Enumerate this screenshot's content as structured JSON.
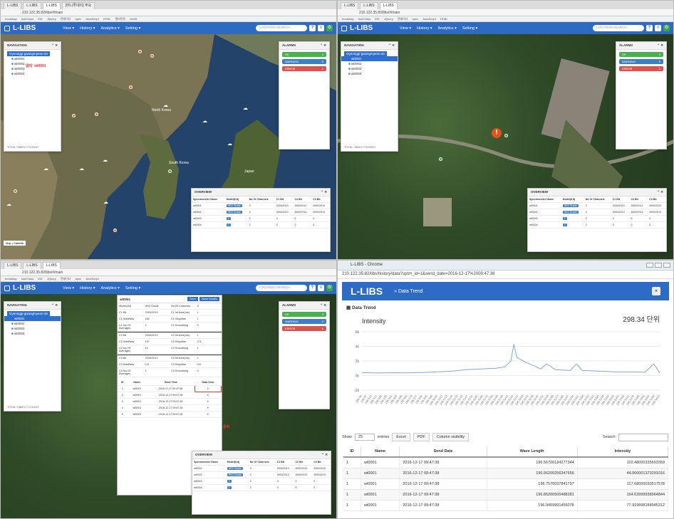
{
  "browser": {
    "tabs": [
      "L-LIBS",
      "L-LIBS",
      "L-LIBS",
      "L-LIBS",
      "[머니투데이] 주요",
      "L-LIBS"
    ],
    "address": "210.122.35.82/libs/#/main",
    "bookmarks": [
      "bootstrap",
      "tool/Class",
      "IDE",
      "JQuery",
      "컨테이너",
      "spec",
      "JavaScript",
      "HTML",
      "엘리먼트",
      "html5",
      "icons",
      "엔지니어",
      "eclipse",
      "SQL",
      "css",
      "부트스트랩",
      "Google",
      "chart",
      "hex",
      "기타 북마크"
    ]
  },
  "app": {
    "brand": "L-LIBS",
    "menus": [
      "View ▾",
      "History ▾",
      "Analytics ▾",
      "Setting ▾"
    ],
    "search_placeholder": "LOCATION SEARCH...",
    "help": "?",
    "power": "⏻"
  },
  "navigation": {
    "title": "NAVIGATION",
    "root": "Gyeonggi-gwangmyeon-do",
    "items": [
      "wt0001",
      "wt0002",
      "wt0003",
      "wt0004"
    ],
    "annotation": "'클릭' wt0001",
    "footer": "TOTAL OBJECT COUNT"
  },
  "alarms": {
    "title": "ALARMS",
    "rows": [
      {
        "label": "OK",
        "count": "3",
        "class": "ok"
      },
      {
        "label": "WARNING",
        "count": "0",
        "class": "warning"
      },
      {
        "label": "ERROR",
        "count": "1",
        "class": "error"
      }
    ]
  },
  "overview": {
    "title": "OVERVIEW",
    "columns": [
      "Spectrometer Name",
      "Model(Kit)",
      "No Of Channels",
      "C1 Bit",
      "C2 Bit",
      "C3 Bit"
    ],
    "rows": [
      [
        "wt0001",
        "HR2 Grade",
        "3",
        "2000/2013",
        "2000/2013",
        "2000/2013"
      ],
      [
        "wt0002",
        "HR2 Grade",
        "3",
        "2000/2013",
        "2000/2013",
        "2000/2013"
      ],
      [
        "wt0003",
        "2",
        "2",
        "0",
        "0",
        "0"
      ],
      [
        "wt0004",
        "2",
        "2",
        "0",
        "0",
        "0"
      ]
    ]
  },
  "map": {
    "countries": [
      "North Korea",
      "South Korea",
      "Japan"
    ],
    "scale_label": "Map",
    "scale_label2": "Satellite"
  },
  "detail": {
    "id": "wt0001",
    "btn_save": "Save",
    "btn_wave": "Wave Details",
    "fields": [
      [
        "Model(Kit)",
        "HR2 Grade",
        "No Of Channels",
        "3"
      ],
      [
        "C1 Bit",
        "2000/2013",
        "C1 Int.time(ms)",
        "1"
      ],
      [
        "C1 StartWav",
        "180",
        "C1 StopWav",
        "1"
      ],
      [
        "C1 No Of Averages",
        "1",
        "C1 Smoothing",
        "0"
      ],
      [
        "C2 Bit",
        "2000/2013",
        "C2 Int.time(ms)",
        "1"
      ],
      [
        "C2 StartWav",
        "197",
        "C2 StopWav",
        "271"
      ],
      [
        "C2 No Of Averages",
        "10",
        "C2 Smoothing",
        "1"
      ],
      [
        "C3 Bit",
        "2000/2013",
        "C3 Int.time(ms)",
        "1"
      ],
      [
        "C3 StartWav",
        "0.8",
        "C3 StopWav",
        "0.8"
      ],
      [
        "C3 No Of Averages",
        "1",
        "C3 Smoothing",
        "0"
      ]
    ],
    "history_cols": [
      "ID",
      "Name",
      "Send Time",
      "Data View"
    ],
    "history_rows": [
      [
        "1",
        "wt0001",
        "2016-12-17 09:47:38",
        "☀"
      ],
      [
        "2",
        "wt0001",
        "2016-12-17 09:47:38",
        "☀"
      ],
      [
        "3",
        "wt0001",
        "2016-12-17 09:47:38",
        "☀"
      ],
      [
        "4",
        "wt0001",
        "2016-12-17 09:47:38",
        "☀"
      ],
      [
        "5",
        "wt0001",
        "2016-12-17 09:47:38",
        "☀"
      ]
    ],
    "click_note": "클릭"
  },
  "popup": {
    "window_title": "L-LIBS - Chrome",
    "url": "210.122.35.82/libs/history/data?sptm_id=1&send_date=2016-12-17%2009:47:38",
    "brand": "L-LIBS",
    "breadcrumb": "» Data Trend",
    "close": "×",
    "section_title": "Data Trend",
    "controls": {
      "show": "Show",
      "show_value": "25",
      "entries": "entries",
      "buttons": [
        "Excel",
        "PDF",
        "Column visibility"
      ],
      "search": "Search:"
    },
    "table": {
      "columns": [
        "ID",
        "Name",
        "Send Date",
        "Wave Length",
        "Intensity"
      ],
      "rows": [
        [
          "1",
          "wt0001",
          "2016-12-17 09:47:38",
          "196.56700134277344",
          "102.48000335693359"
        ],
        [
          "1",
          "wt0001",
          "2016-12-17 09:47:38",
          "196.66200256347656",
          "44.060001373291016"
        ],
        [
          "1",
          "wt0001",
          "2016-12-17 09:47:38",
          "196.7570037841797",
          "117.68000030517578"
        ],
        [
          "1",
          "wt0001",
          "2016-12-17 09:47:38",
          "196.85200500488281",
          "164.63999938964844"
        ],
        [
          "1",
          "wt0001",
          "2016-12-17 09:47:38",
          "196.9459991455078",
          "77.919998168945312"
        ]
      ]
    }
  },
  "chart_data": {
    "type": "line",
    "title": "Intensity",
    "value_label": "298.34 단위",
    "yticks": [
      "6k",
      "4k",
      "2k",
      "0k",
      "-2k"
    ],
    "ylim": [
      -2000,
      6000
    ],
    "series": [
      {
        "color": "#7aa9de",
        "x": [
          0,
          5,
          10,
          15,
          20,
          25,
          30,
          35,
          40,
          45,
          48,
          50,
          51,
          52,
          55,
          58,
          60,
          62,
          65,
          70,
          72,
          74,
          80,
          85,
          90,
          95,
          98,
          100
        ],
        "values": [
          400,
          350,
          380,
          360,
          420,
          500,
          600,
          800,
          900,
          1000,
          1200,
          2000,
          4300,
          2500,
          1800,
          1300,
          900,
          1600,
          800,
          700,
          1600,
          700,
          600,
          500,
          500,
          450,
          1600,
          350
        ]
      }
    ]
  },
  "colors": {
    "brand": "#2c6ac4",
    "ok": "#48b04f",
    "warning": "#3d7fc7",
    "error": "#d9534f"
  }
}
